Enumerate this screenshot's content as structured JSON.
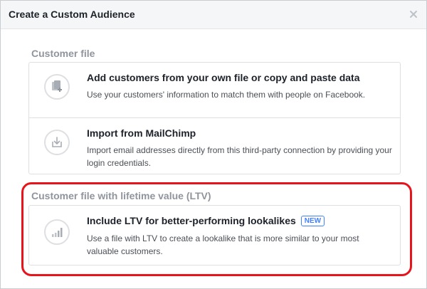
{
  "dialog": {
    "title": "Create a Custom Audience",
    "close_label": "×"
  },
  "sections": [
    {
      "title": "Customer file",
      "cards": [
        {
          "title": "Add customers from your own file or copy and paste data",
          "description": "Use your customers' information to match them with people on Facebook.",
          "icon": "file-add-icon"
        },
        {
          "title": "Import from MailChimp",
          "description": "Import email addresses directly from this third-party connection by providing your login credentials.",
          "icon": "import-icon"
        }
      ]
    },
    {
      "title": "Customer file with lifetime value (LTV)",
      "cards": [
        {
          "title": "Include LTV for better-performing lookalikes",
          "badge": "NEW",
          "description": "Use a file with LTV to create a lookalike that is more similar to your most valuable customers.",
          "icon": "bar-chart-icon"
        }
      ]
    }
  ],
  "colors": {
    "highlight": "#e8141c",
    "badge": "#4080ff",
    "section_title": "#90949c"
  }
}
